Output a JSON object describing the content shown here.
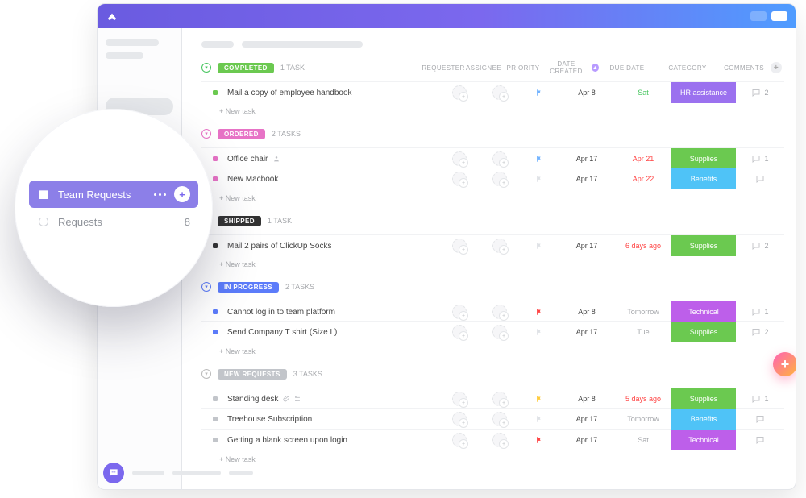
{
  "titlebar": {
    "brand": "ClickUp"
  },
  "magnifier": {
    "active_label": "Team Requests",
    "sub_label": "Requests",
    "sub_count": "8"
  },
  "columns": {
    "requester": "REQUESTER",
    "assignee": "ASSIGNEE",
    "priority": "PRIORITY",
    "date_created": "DATE CREATED",
    "due_date": "DUE DATE",
    "category": "CATEGORY",
    "comments": "COMMENTS"
  },
  "category_labels": {
    "hr": "HR assistance",
    "supplies": "Supplies",
    "benefits": "Benefits",
    "technical": "Technical"
  },
  "new_task_label": "+ New task",
  "groups": [
    {
      "id": "completed",
      "label": "COMPLETED",
      "count_label": "1 TASK",
      "tasks": [
        {
          "title": "Mail a copy of employee handbook",
          "flag": "blue",
          "date": "Apr 8",
          "due": "Sat",
          "due_class": "green",
          "category": "hr",
          "comments": "2",
          "status_color": "#6bc950"
        }
      ]
    },
    {
      "id": "ordered",
      "label": "ORDERED",
      "count_label": "2 TASKS",
      "tasks": [
        {
          "title": "Office chair",
          "flag": "blue",
          "date": "Apr 17",
          "due": "Apr 21",
          "due_class": "red",
          "category": "supplies",
          "comments": "1",
          "status_color": "#e773c6",
          "icons": [
            "user"
          ]
        },
        {
          "title": "New Macbook",
          "flag": "clear",
          "date": "Apr 17",
          "due": "Apr 22",
          "due_class": "red",
          "category": "benefits",
          "comments": "",
          "status_color": "#e773c6"
        }
      ]
    },
    {
      "id": "shipped",
      "label": "SHIPPED",
      "count_label": "1 TASK",
      "tasks": [
        {
          "title": "Mail 2 pairs of ClickUp Socks",
          "flag": "clear",
          "date": "Apr 17",
          "due": "6 days ago",
          "due_class": "red",
          "category": "supplies",
          "comments": "2",
          "status_color": "#333"
        }
      ]
    },
    {
      "id": "in_progress",
      "label": "IN PROGRESS",
      "count_label": "2 TASKS",
      "tasks": [
        {
          "title": "Cannot log in to team platform",
          "flag": "red",
          "date": "Apr 8",
          "due": "Tomorrow",
          "due_class": "",
          "category": "technical",
          "comments": "1",
          "status_color": "#5c7cfa"
        },
        {
          "title": "Send Company T shirt (Size L)",
          "flag": "clear",
          "date": "Apr 17",
          "due": "Tue",
          "due_class": "",
          "category": "supplies",
          "comments": "2",
          "status_color": "#5c7cfa"
        }
      ]
    },
    {
      "id": "new_requests",
      "label": "NEW REQUESTS",
      "count_label": "3 TASKS",
      "tasks": [
        {
          "title": "Standing desk",
          "flag": "yellow",
          "date": "Apr 8",
          "due": "5 days ago",
          "due_class": "red",
          "category": "supplies",
          "comments": "1",
          "status_color": "#c2c5ca",
          "icons": [
            "attach",
            "sub"
          ]
        },
        {
          "title": "Treehouse Subscription",
          "flag": "clear",
          "date": "Apr 17",
          "due": "Tomorrow",
          "due_class": "",
          "category": "benefits",
          "comments": "",
          "status_color": "#c2c5ca"
        },
        {
          "title": "Getting a blank screen upon login",
          "flag": "red",
          "date": "Apr 17",
          "due": "Sat",
          "due_class": "",
          "category": "technical",
          "comments": "",
          "status_color": "#c2c5ca"
        }
      ]
    }
  ]
}
